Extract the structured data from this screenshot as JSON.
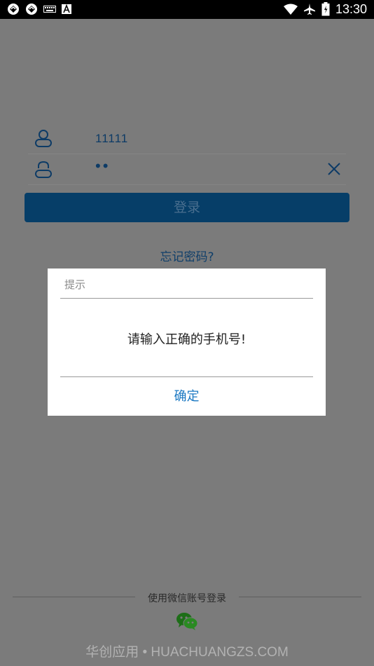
{
  "status_bar": {
    "time": "13:30",
    "icons": [
      "app-icon",
      "app-icon",
      "keyboard-icon",
      "a-icon",
      "wifi-icon",
      "airplane-icon",
      "battery-icon"
    ]
  },
  "login": {
    "username_value": "11111",
    "password_value": "••",
    "login_label": "登录",
    "forgot_label": "忘记密码?"
  },
  "dialog": {
    "title": "提示",
    "message": "请输入正确的手机号!",
    "confirm_label": "确定"
  },
  "wechat": {
    "label": "使用微信账号登录"
  },
  "watermark": "华创应用 • HUACHUANGZS.COM",
  "colors": {
    "primary": "#063e68",
    "dialog_button": "#1a78c2",
    "overlay": "#7b7b7b"
  }
}
